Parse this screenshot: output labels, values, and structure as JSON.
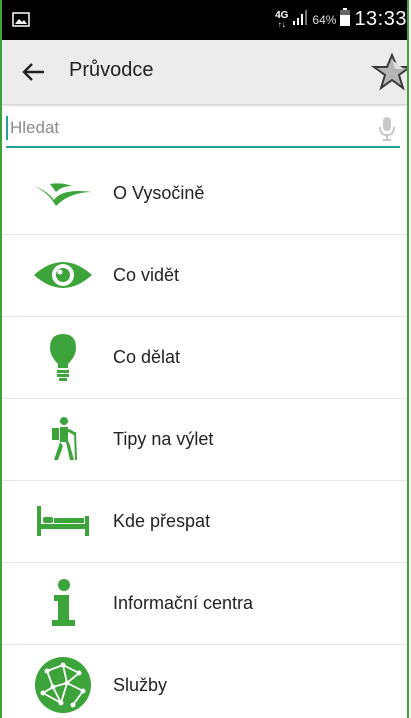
{
  "status_bar": {
    "network_top": "4G",
    "network_bottom": "↑↓",
    "battery_percent": "64%",
    "time": "13:33"
  },
  "toolbar": {
    "title": "Průvodce",
    "back_icon": "arrow-left-icon",
    "favorite_icon": "star-icon"
  },
  "search": {
    "placeholder": "Hledat",
    "value": "",
    "mic_icon": "microphone-icon"
  },
  "menu": {
    "items": [
      {
        "label": "O Vysočině",
        "icon": "vysocina-logo-icon"
      },
      {
        "label": "Co vidět",
        "icon": "eye-icon"
      },
      {
        "label": "Co dělat",
        "icon": "lightbulb-icon"
      },
      {
        "label": "Tipy na výlet",
        "icon": "hiker-icon"
      },
      {
        "label": "Kde přespat",
        "icon": "bed-icon"
      },
      {
        "label": "Informační centra",
        "icon": "info-icon"
      },
      {
        "label": "Služby",
        "icon": "network-globe-icon"
      }
    ]
  },
  "colors": {
    "accent_green": "#3ca43a",
    "search_underline": "#2aa198",
    "toolbar_bg": "#ececec",
    "statusbar_bg": "#000000"
  }
}
